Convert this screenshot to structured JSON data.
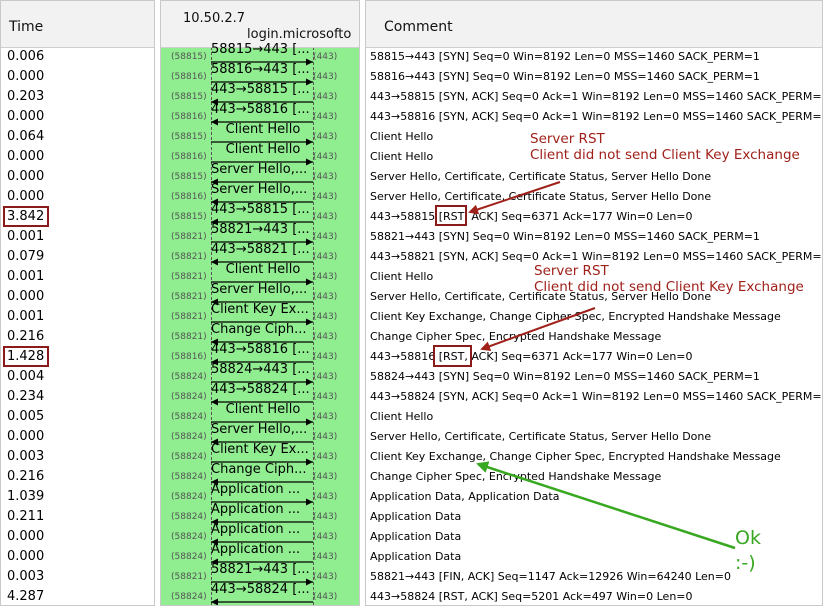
{
  "columns": {
    "time": "Time",
    "host_a": "10.50.2.7",
    "host_b": "login.microsofto",
    "comment": "Comment"
  },
  "colors": {
    "flow_bg": "#90ee90",
    "annotation_red": "#a0201a",
    "annotation_green": "#38a820",
    "highlight_box": "#8b1a1a"
  },
  "rows": [
    {
      "time": "0.006",
      "flow": "58815→443 [...",
      "dir": "right",
      "port_a": "(58815)",
      "port_b": "(443)",
      "comment": "58815→443 [SYN] Seq=0 Win=8192 Len=0 MSS=1460 SACK_PERM=1"
    },
    {
      "time": "0.000",
      "flow": "58816→443 [...",
      "dir": "right",
      "port_a": "(58816)",
      "port_b": "(443)",
      "comment": "58816→443 [SYN] Seq=0 Win=8192 Len=0 MSS=1460 SACK_PERM=1"
    },
    {
      "time": "0.203",
      "flow": "443→58815 [...",
      "dir": "left",
      "port_a": "(58815)",
      "port_b": "(443)",
      "comment": "443→58815 [SYN, ACK] Seq=0 Ack=1 Win=8192 Len=0 MSS=1460 SACK_PERM=1"
    },
    {
      "time": "0.000",
      "flow": "443→58816 [...",
      "dir": "left",
      "port_a": "(58816)",
      "port_b": "(443)",
      "comment": "443→58816 [SYN, ACK] Seq=0 Ack=1 Win=8192 Len=0 MSS=1460 SACK_PERM=1"
    },
    {
      "time": "0.064",
      "flow": "Client Hello",
      "dir": "right",
      "port_a": "(58815)",
      "port_b": "(443)",
      "comment": "Client Hello"
    },
    {
      "time": "0.000",
      "flow": "Client Hello",
      "dir": "right",
      "port_a": "(58816)",
      "port_b": "(443)",
      "comment": "Client Hello"
    },
    {
      "time": "0.000",
      "flow": "Server Hello,...",
      "dir": "left",
      "port_a": "(58815)",
      "port_b": "(443)",
      "comment": "Server Hello, Certificate, Certificate Status, Server Hello Done"
    },
    {
      "time": "0.000",
      "flow": "Server Hello,...",
      "dir": "left",
      "port_a": "(58816)",
      "port_b": "(443)",
      "comment": "Server Hello, Certificate, Certificate Status, Server Hello Done"
    },
    {
      "time": "3.842",
      "flow": "443→58815 [...",
      "dir": "left",
      "port_a": "(58815)",
      "port_b": "(443)",
      "comment": "443→58815 [RST, ACK] Seq=6371 Ack=177 Win=0 Len=0"
    },
    {
      "time": "0.001",
      "flow": "58821→443 [...",
      "dir": "right",
      "port_a": "(58821)",
      "port_b": "(443)",
      "comment": "58821→443 [SYN] Seq=0 Win=8192 Len=0 MSS=1460 SACK_PERM=1"
    },
    {
      "time": "0.079",
      "flow": "443→58821 [...",
      "dir": "left",
      "port_a": "(58821)",
      "port_b": "(443)",
      "comment": "443→58821 [SYN, ACK] Seq=0 Ack=1 Win=8192 Len=0 MSS=1460 SACK_PERM=1"
    },
    {
      "time": "0.001",
      "flow": "Client Hello",
      "dir": "right",
      "port_a": "(58821)",
      "port_b": "(443)",
      "comment": "Client Hello"
    },
    {
      "time": "0.000",
      "flow": "Server Hello,...",
      "dir": "left",
      "port_a": "(58821)",
      "port_b": "(443)",
      "comment": "Server Hello, Certificate, Certificate Status, Server Hello Done"
    },
    {
      "time": "0.001",
      "flow": "Client Key Ex...",
      "dir": "right",
      "port_a": "(58821)",
      "port_b": "(443)",
      "comment": "Client Key Exchange, Change Cipher Spec, Encrypted Handshake Message"
    },
    {
      "time": "0.216",
      "flow": "Change Ciph...",
      "dir": "left",
      "port_a": "(58821)",
      "port_b": "(443)",
      "comment": "Change Cipher Spec, Encrypted Handshake Message"
    },
    {
      "time": "1.428",
      "flow": "443→58816 [...",
      "dir": "left",
      "port_a": "(58816)",
      "port_b": "(443)",
      "comment": "443→58816 [RST, ACK] Seq=6371 Ack=177 Win=0 Len=0"
    },
    {
      "time": "0.004",
      "flow": "58824→443 [...",
      "dir": "right",
      "port_a": "(58824)",
      "port_b": "(443)",
      "comment": "58824→443 [SYN] Seq=0 Win=8192 Len=0 MSS=1460 SACK_PERM=1"
    },
    {
      "time": "0.234",
      "flow": "443→58824 [...",
      "dir": "left",
      "port_a": "(58824)",
      "port_b": "(443)",
      "comment": "443→58824 [SYN, ACK] Seq=0 Ack=1 Win=8192 Len=0 MSS=1460 SACK_PERM=1"
    },
    {
      "time": "0.005",
      "flow": "Client Hello",
      "dir": "right",
      "port_a": "(58824)",
      "port_b": "(443)",
      "comment": "Client Hello"
    },
    {
      "time": "0.000",
      "flow": "Server Hello,...",
      "dir": "left",
      "port_a": "(58824)",
      "port_b": "(443)",
      "comment": "Server Hello, Certificate, Certificate Status, Server Hello Done"
    },
    {
      "time": "0.003",
      "flow": "Client Key Ex...",
      "dir": "right",
      "port_a": "(58824)",
      "port_b": "(443)",
      "comment": "Client Key Exchange, Change Cipher Spec, Encrypted Handshake Message"
    },
    {
      "time": "0.216",
      "flow": "Change Ciph...",
      "dir": "left",
      "port_a": "(58824)",
      "port_b": "(443)",
      "comment": "Change Cipher Spec, Encrypted Handshake Message"
    },
    {
      "time": "1.039",
      "flow": "Application ...",
      "dir": "right",
      "port_a": "(58824)",
      "port_b": "(443)",
      "comment": "Application Data, Application Data"
    },
    {
      "time": "0.211",
      "flow": "Application ...",
      "dir": "left",
      "port_a": "(58824)",
      "port_b": "(443)",
      "comment": "Application Data"
    },
    {
      "time": "0.000",
      "flow": "Application ...",
      "dir": "left",
      "port_a": "(58824)",
      "port_b": "(443)",
      "comment": "Application Data"
    },
    {
      "time": "0.000",
      "flow": "Application ...",
      "dir": "left",
      "port_a": "(58824)",
      "port_b": "(443)",
      "comment": "Application Data"
    },
    {
      "time": "0.003",
      "flow": "58821→443 [...",
      "dir": "right",
      "port_a": "(58821)",
      "port_b": "(443)",
      "comment": "58821→443 [FIN, ACK] Seq=1147 Ack=12926 Win=64240 Len=0"
    },
    {
      "time": "4.287",
      "flow": "443→58824 [...",
      "dir": "left",
      "port_a": "(58824)",
      "port_b": "(443)",
      "comment": "443→58824 [RST, ACK] Seq=5201 Ack=497 Win=0 Len=0"
    }
  ],
  "annotations": {
    "rst1_title": "Server RST",
    "rst1_note": "Client did not send Client Key Exchange",
    "rst2_title": "Server RST",
    "rst2_note": "Client did not send Client Key Exchange",
    "ok_line1": "Ok",
    "ok_line2": ":-)"
  }
}
